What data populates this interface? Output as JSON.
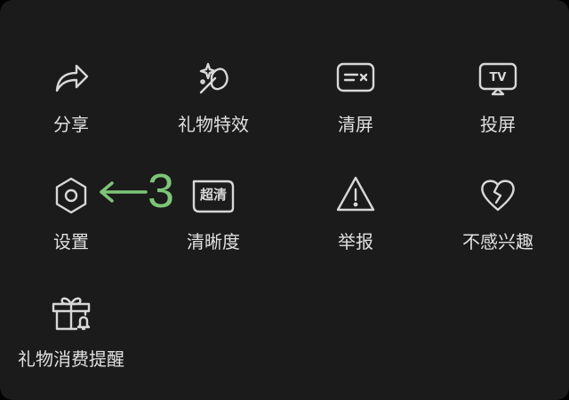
{
  "colors": {
    "background": "#1b1b1b",
    "text": "#e0e0e0",
    "icon": "#d8d8d8",
    "annotation": "#7cc576"
  },
  "menu": {
    "items": [
      {
        "label": "分享",
        "icon": "share-icon"
      },
      {
        "label": "礼物特效",
        "icon": "gift-effect-icon"
      },
      {
        "label": "清屏",
        "icon": "clear-screen-icon"
      },
      {
        "label": "投屏",
        "icon": "tv-cast-icon"
      },
      {
        "label": "设置",
        "icon": "settings-icon"
      },
      {
        "label": "清晰度",
        "icon": "resolution-icon",
        "badge": "超清"
      },
      {
        "label": "举报",
        "icon": "warning-icon"
      },
      {
        "label": "不感兴趣",
        "icon": "broken-heart-icon"
      },
      {
        "label": "礼物消费提醒",
        "icon": "gift-reminder-icon"
      }
    ]
  },
  "annotation": {
    "text": "3"
  },
  "tv_text": "TV"
}
